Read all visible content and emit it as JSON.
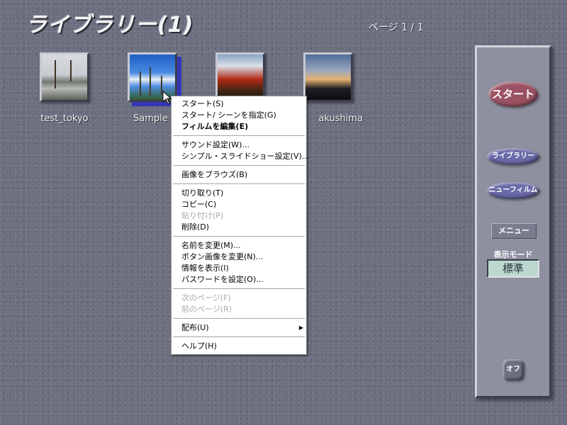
{
  "header": {
    "title": "ライブラリー(1)",
    "page_indicator": "ページ 1 / 1"
  },
  "thumbnails": [
    {
      "caption": "test_tokyo",
      "selected": false,
      "icon": "photo-river-tree"
    },
    {
      "caption": "Sample",
      "selected": true,
      "icon": "photo-palm-beach"
    },
    {
      "caption": "",
      "selected": false,
      "icon": "photo-autumn-tree"
    },
    {
      "caption": "akushima",
      "selected": false,
      "icon": "photo-sunset"
    }
  ],
  "side_panel": {
    "start_label": "スタート",
    "library_label": "ライブラリー",
    "new_film_label": "ニューフィルム",
    "menu_label": "メニュー",
    "mode_label": "表示モード",
    "mode_value": "標準",
    "off_label": "オフ"
  },
  "context_menu": {
    "start": "スタート(S)",
    "start_scene": "スタート/ シーンを指定(G)",
    "edit_film": "フィルムを編集(E)",
    "sound_settings": "サウンド設定(W)...",
    "slideshow_settings": "シンプル・スライドショー設定(V)...",
    "browse_images": "画像をブラウズ(B)",
    "cut": "切り取り(T)",
    "copy": "コピー(C)",
    "paste": "貼り付け(P)",
    "delete": "削除(D)",
    "rename": "名前を変更(M)...",
    "change_button_image": "ボタン画像を変更(N)...",
    "show_info": "情報を表示(I)",
    "set_password": "パスワードを設定(O)...",
    "next_page": "次のページ(F)",
    "prev_page": "前のページ(R)",
    "distribute": "配布(U)",
    "help": "ヘルプ(H)"
  },
  "colors": {
    "background": "#6b6e7e",
    "start_button": "#9b5363",
    "nav_button": "#6a6aa8",
    "mode_box": "#bcd7cf",
    "selection": "#3636b8"
  }
}
